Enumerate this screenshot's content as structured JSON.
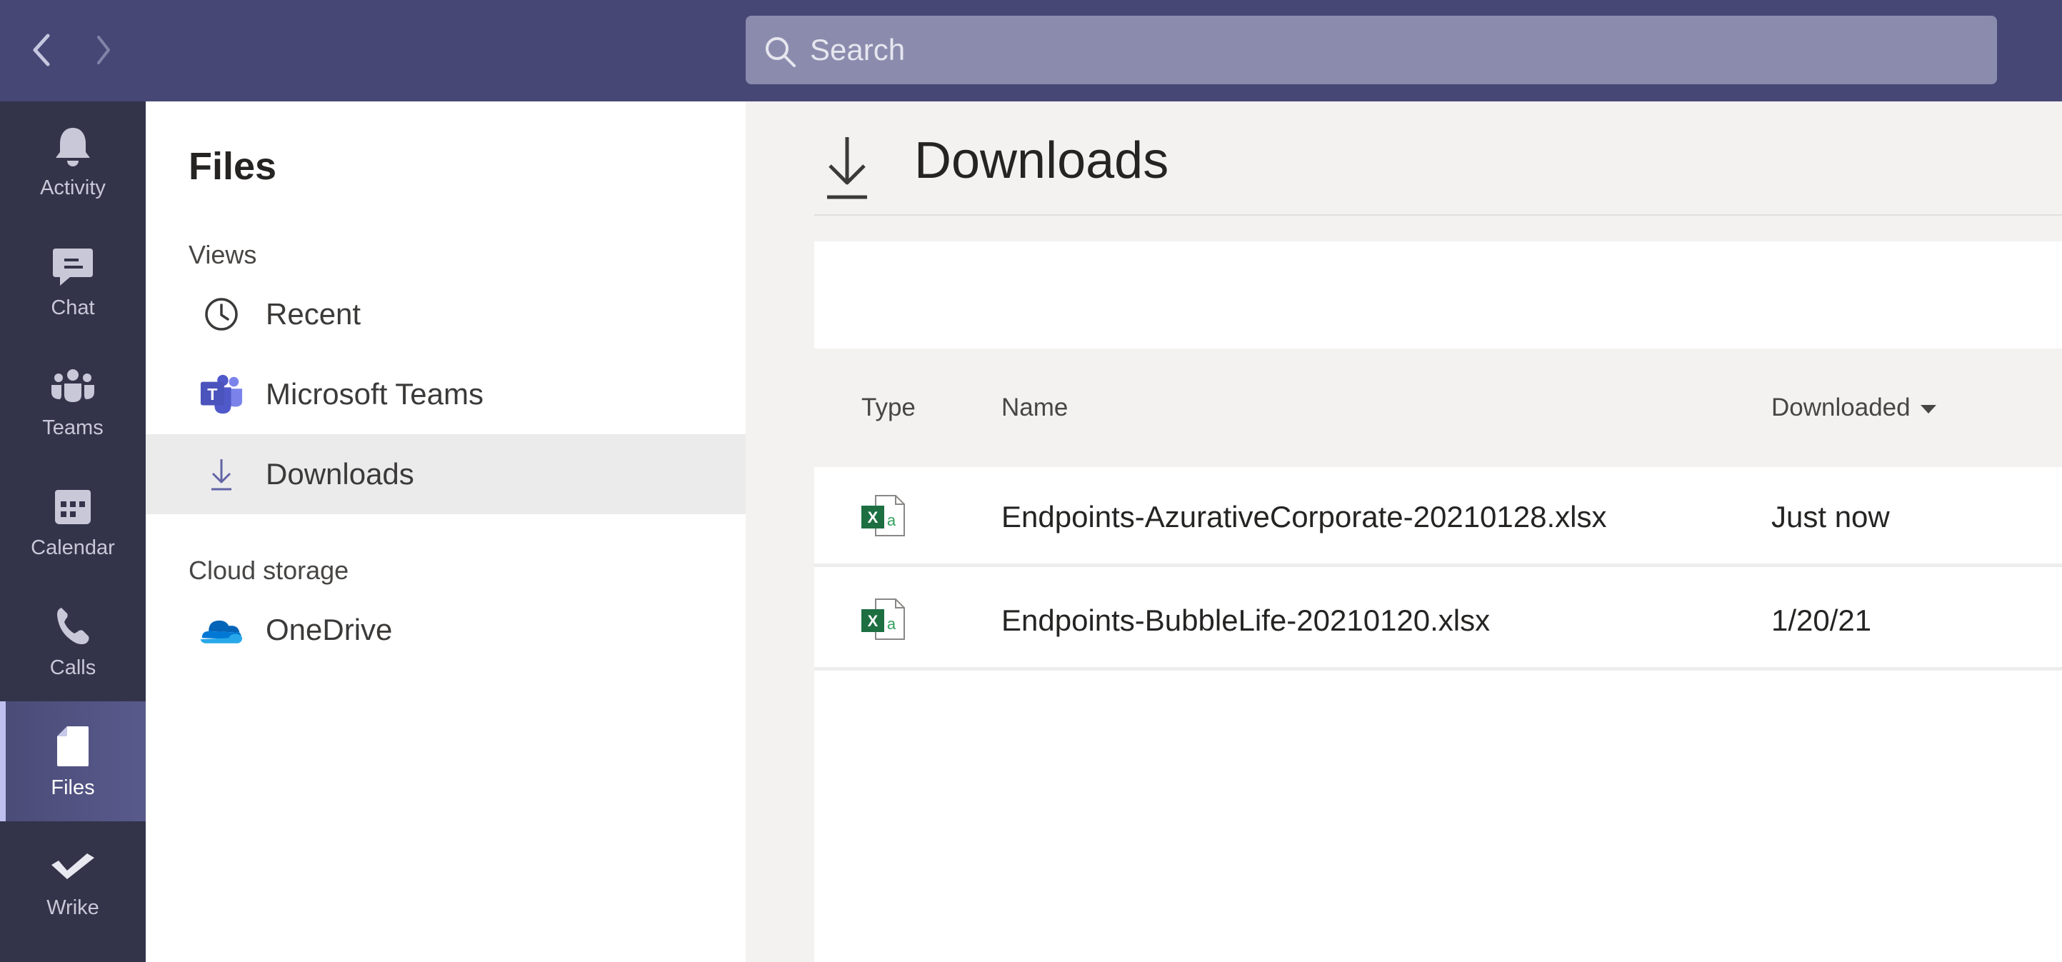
{
  "search": {
    "placeholder": "Search"
  },
  "rail": {
    "items": [
      {
        "label": "Activity",
        "icon": "bell-icon"
      },
      {
        "label": "Chat",
        "icon": "chat-icon"
      },
      {
        "label": "Teams",
        "icon": "teams-icon"
      },
      {
        "label": "Calendar",
        "icon": "calendar-icon"
      },
      {
        "label": "Calls",
        "icon": "phone-icon"
      },
      {
        "label": "Files",
        "icon": "file-icon",
        "active": true
      },
      {
        "label": "Wrike",
        "icon": "wrike-icon"
      }
    ]
  },
  "leftpane": {
    "title": "Files",
    "views_label": "Views",
    "views": [
      {
        "label": "Recent",
        "icon": "clock-icon"
      },
      {
        "label": "Microsoft Teams",
        "icon": "microsoft-teams-icon"
      },
      {
        "label": "Downloads",
        "icon": "download-icon",
        "selected": true
      }
    ],
    "cloud_label": "Cloud storage",
    "cloud": [
      {
        "label": "OneDrive",
        "icon": "onedrive-icon"
      }
    ]
  },
  "main": {
    "title": "Downloads",
    "columns": {
      "type": "Type",
      "name": "Name",
      "downloaded": "Downloaded"
    },
    "files": [
      {
        "name": "Endpoints-AzurativeCorporate-20210128.xlsx",
        "downloaded": "Just now",
        "icon": "excel-file-icon"
      },
      {
        "name": "Endpoints-BubbleLife-20210120.xlsx",
        "downloaded": "1/20/21",
        "icon": "excel-file-icon"
      }
    ]
  },
  "colors": {
    "topbar": "#464775",
    "rail": "#33344a",
    "accent": "#6264a7",
    "excel_green": "#1d6f42"
  }
}
